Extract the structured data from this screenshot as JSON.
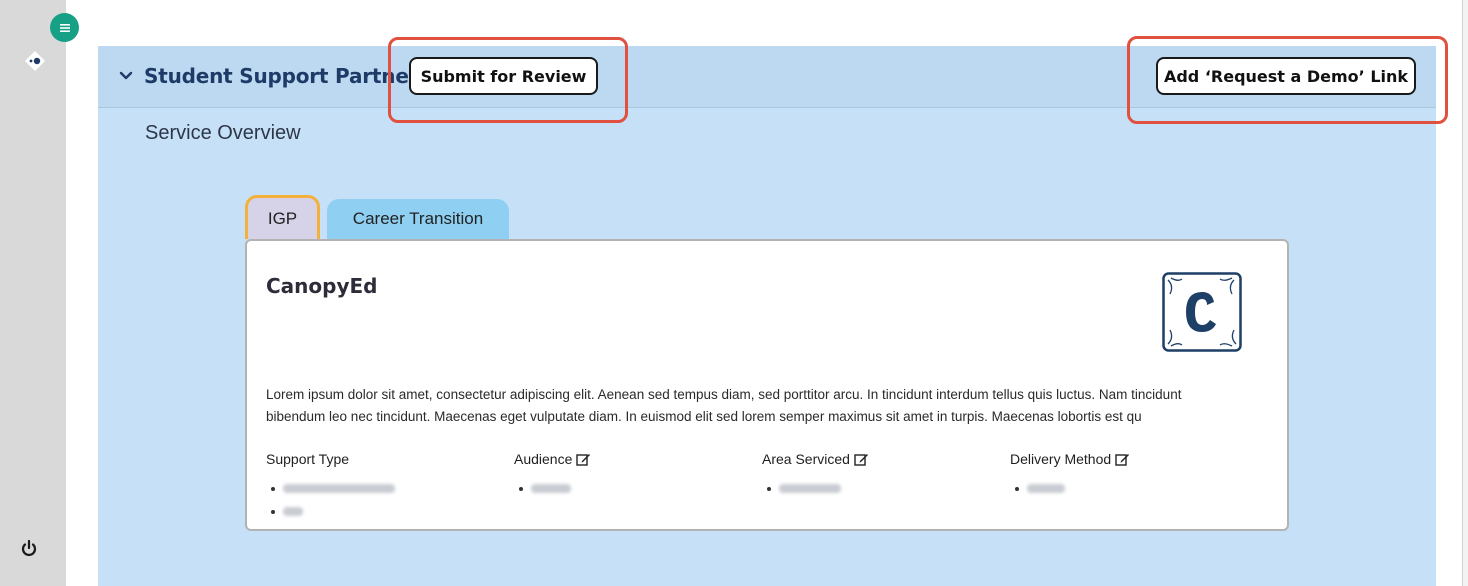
{
  "panel": {
    "title": "Student Support Partner",
    "submit_label": "Submit for Review",
    "demo_link_label": "Add ‘Request a Demo’ Link",
    "section_title": "Service Overview"
  },
  "tabs": [
    {
      "label": "IGP",
      "active": true
    },
    {
      "label": "Career Transition",
      "active": false
    }
  ],
  "card": {
    "title": "CanopyEd",
    "logo_letter": "C",
    "description_line1": "Lorem ipsum dolor sit amet, consectetur adipiscing elit. Aenean sed tempus diam, sed porttitor arcu. In tincidunt interdum tellus quis luctus. Nam tincidunt",
    "description_line2": "bibendum leo nec tincidunt. Maecenas eget vulputate diam. In euismod elit sed lorem semper maximus sit amet in turpis. Maecenas lobortis est qu",
    "attributes": [
      {
        "label": "Support Type",
        "editable": false
      },
      {
        "label": "Audience",
        "editable": true
      },
      {
        "label": "Area Serviced",
        "editable": true
      },
      {
        "label": "Delivery Method",
        "editable": true
      }
    ]
  },
  "icons": {
    "menu": "menu-icon",
    "logo": "app-logo-icon",
    "power": "power-icon",
    "chevron": "chevron-down-icon",
    "edit": "edit-icon"
  },
  "colors": {
    "accent_teal": "#16a085",
    "panel_bg": "#c6e0f7",
    "title_navy": "#1d3b66",
    "highlight_red": "#e0513f",
    "active_tab_border": "#f3b03a"
  }
}
